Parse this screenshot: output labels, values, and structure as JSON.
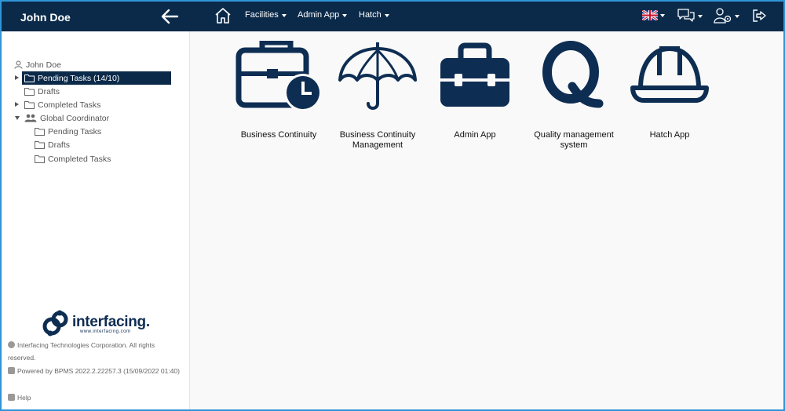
{
  "sidebar": {
    "user_name": "John Doe",
    "tree": {
      "root": "John Doe",
      "items": [
        {
          "label": "Pending Tasks (14/10)"
        },
        {
          "label": "Drafts"
        },
        {
          "label": "Completed Tasks"
        },
        {
          "label": "Global Coordinator"
        },
        {
          "label": "Pending Tasks"
        },
        {
          "label": "Drafts"
        },
        {
          "label": "Completed Tasks"
        }
      ]
    },
    "footer": {
      "copyright": "Interfacing Technologies Corporation. All rights reserved.",
      "powered": "Powered by BPMS 2022.2.22257.3 (15/09/2022 01:40)",
      "help": "Help",
      "logo_text": "interfacing.",
      "logo_url": "www.interfacing.com"
    }
  },
  "topbar": {
    "menus": [
      "Facilities",
      "Admin App",
      "Hatch"
    ],
    "icons": [
      "home-icon",
      "uk-flag-icon",
      "chat-icon",
      "user-settings-icon",
      "logout-icon"
    ]
  },
  "apps": [
    {
      "label": "Business Continuity",
      "icon": "briefcase-clock-icon"
    },
    {
      "label": "Business Continuity Management",
      "icon": "umbrella-icon"
    },
    {
      "label": "Admin App",
      "icon": "toolbox-icon"
    },
    {
      "label": "Quality management system",
      "icon": "q-icon"
    },
    {
      "label": "Hatch App",
      "icon": "hard-hat-icon"
    }
  ],
  "colors": {
    "navy": "#0b2a4a",
    "icon": "#0e2d52",
    "border": "#2f95d8"
  }
}
